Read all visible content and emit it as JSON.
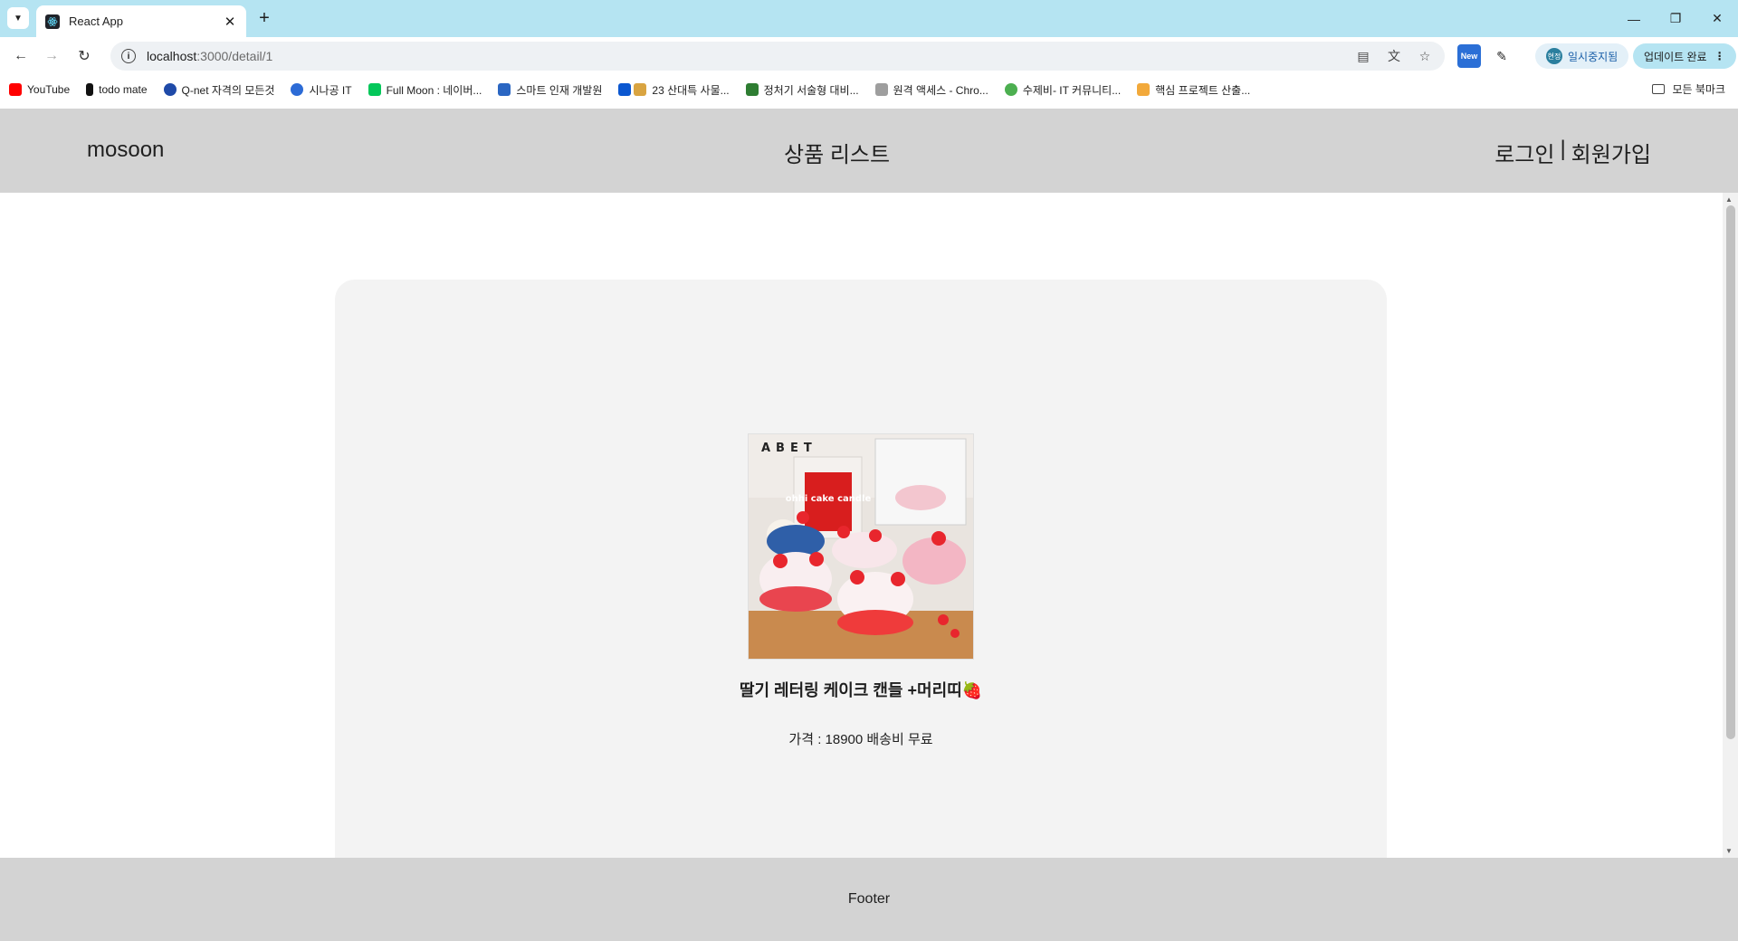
{
  "browser": {
    "tab_title": "React App",
    "url_host": "localhost",
    "url_path": ":3000/detail/1",
    "profile_pill": "일시중지됨",
    "update_pill": "업데이트 완료",
    "ext_new_label": "New"
  },
  "bookmarks": [
    {
      "label": "YouTube",
      "color": "#ff0000"
    },
    {
      "label": "todo mate",
      "color": "#111111"
    },
    {
      "label": "Q-net 자격의 모든것",
      "color": "#1f4aa8"
    },
    {
      "label": "시나공 IT",
      "color": "#2c6bd6"
    },
    {
      "label": "Full Moon : 네이버...",
      "color": "#03c75a"
    },
    {
      "label": "스마트 인재 개발원",
      "color": "#2a66c2"
    },
    {
      "label": "23 산대특 사물...",
      "color": "#0b57d0"
    },
    {
      "label": "정처기 서술형 대비...",
      "color": "#2e7d32"
    },
    {
      "label": "원격 액세스 - Chro...",
      "color": "#9e9e9e"
    },
    {
      "label": "수제비- IT 커뮤니티...",
      "color": "#4caf50"
    },
    {
      "label": "핵심 프로젝트 산출...",
      "color": "#f2a93b"
    }
  ],
  "bookmarks_all": "모든 북마크",
  "header": {
    "logo": "mosoon",
    "nav_center": "상품 리스트",
    "login": "로그인",
    "separator": "|",
    "signup": "회원가입"
  },
  "product": {
    "image_brand_text": "ABET",
    "image_box_text": "ohhi cake candle",
    "name": "딸기 레터링 케이크 캔들 +머리띠🍓",
    "price_text": "가격 : 18900 배송비 무료"
  },
  "footer": {
    "text": "Footer"
  }
}
